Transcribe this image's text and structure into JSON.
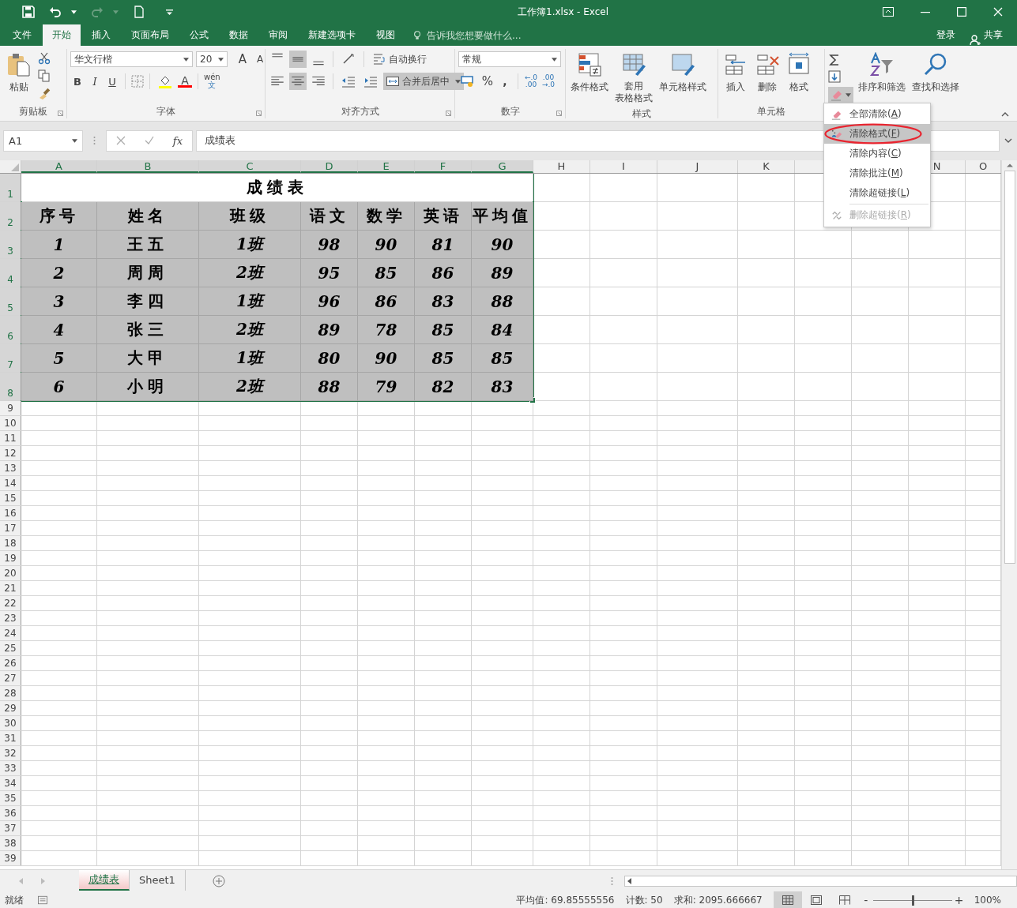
{
  "window": {
    "title": "工作簿1.xlsx - Excel"
  },
  "ribbon_tabs": [
    {
      "label": "文件",
      "selected": false
    },
    {
      "label": "开始",
      "selected": true
    },
    {
      "label": "插入",
      "selected": false
    },
    {
      "label": "页面布局",
      "selected": false
    },
    {
      "label": "公式",
      "selected": false
    },
    {
      "label": "数据",
      "selected": false
    },
    {
      "label": "审阅",
      "selected": false
    },
    {
      "label": "新建选项卡",
      "selected": false
    },
    {
      "label": "视图",
      "selected": false
    }
  ],
  "tell_me": {
    "placeholder": "告诉我您想要做什么..."
  },
  "account": {
    "sign_in": "登录",
    "share": "共享"
  },
  "clipboard": {
    "label": "剪贴板",
    "paste": "粘贴"
  },
  "font": {
    "label": "字体",
    "font_name": "华文行楷",
    "font_size": "20",
    "grow": "A",
    "shrink": "A",
    "bold": "B",
    "italic": "I",
    "underline": "U",
    "font_color_letter": "A",
    "phonetic": {
      "top": "wén",
      "bottom": "文"
    }
  },
  "alignment": {
    "label": "对齐方式",
    "vertical": [
      {
        "kind": "top",
        "selected": false
      },
      {
        "kind": "middle",
        "selected": true
      },
      {
        "kind": "bottom",
        "selected": false
      }
    ],
    "horizontal": [
      {
        "kind": "left",
        "selected": false
      },
      {
        "kind": "center",
        "selected": true
      },
      {
        "kind": "right",
        "selected": false
      }
    ],
    "wrap_text": "自动换行",
    "merge_center": {
      "label": "合并后居中",
      "selected": true
    }
  },
  "number": {
    "label": "数字",
    "format": "常规",
    "percent": "%",
    "comma": ",",
    "increase_decimal": {
      "top": "←.0",
      "bottom": ".00"
    },
    "decrease_decimal": {
      "top": ".00",
      "bottom": "→.0"
    }
  },
  "styles": {
    "label": "样式",
    "conditional": "条件格式",
    "table_format": [
      "套用",
      "表格格式"
    ],
    "cell_styles": "单元格样式"
  },
  "cells": {
    "label": "单元格",
    "insert": "插入",
    "delete": "删除",
    "format": "格式"
  },
  "editing": {
    "sort_filter": "排序和筛选",
    "find_select": "查找和选择",
    "clear_expanded": true
  },
  "clear_menu": [
    {
      "kind": "eraser",
      "before": "全部清除(",
      "key": "A",
      "after": ")",
      "selected": false,
      "circled": false,
      "disabled": false
    },
    {
      "kind": "format",
      "before": "清除格式(",
      "key": "F",
      "after": ")",
      "selected": true,
      "circled": true,
      "disabled": false
    },
    {
      "kind": "none",
      "before": "清除内容(",
      "key": "C",
      "after": ")",
      "selected": false,
      "circled": false,
      "disabled": false
    },
    {
      "kind": "none",
      "before": "清除批注(",
      "key": "M",
      "after": ")",
      "selected": false,
      "circled": false,
      "disabled": false
    },
    {
      "kind": "none",
      "before": "清除超链接(",
      "key": "L",
      "after": ")",
      "selected": false,
      "circled": false,
      "disabled": false
    },
    {
      "kind": "unlink",
      "before": "删除超链接(",
      "key": "R",
      "after": ")",
      "selected": false,
      "circled": false,
      "disabled": true
    }
  ],
  "formula_bar": {
    "name_box": "A1",
    "function_label": "fx",
    "value": "成绩表"
  },
  "sheet": {
    "columns": [
      "A",
      "B",
      "C",
      "D",
      "E",
      "F",
      "G",
      "H",
      "I",
      "J",
      "K",
      "N",
      "O"
    ],
    "row_numbers": [
      "1",
      "2",
      "3",
      "4",
      "5",
      "6",
      "7",
      "8",
      "9",
      "10",
      "11",
      "12",
      "13",
      "14",
      "15",
      "16",
      "17",
      "18",
      "19",
      "20",
      "21",
      "22",
      "23",
      "24",
      "25",
      "26",
      "27",
      "28",
      "29",
      "30",
      "31",
      "32",
      "33",
      "34",
      "35",
      "36",
      "37",
      "38",
      "39"
    ],
    "title": "成绩表",
    "headers": [
      "序号",
      "姓名",
      "班级",
      "语文",
      "数学",
      "英语",
      "平均值"
    ],
    "rows": [
      [
        "1",
        "王五",
        "1班",
        "98",
        "90",
        "81",
        "90"
      ],
      [
        "2",
        "周周",
        "2班",
        "95",
        "85",
        "86",
        "89"
      ],
      [
        "3",
        "李四",
        "1班",
        "96",
        "86",
        "83",
        "88"
      ],
      [
        "4",
        "张三",
        "2班",
        "89",
        "78",
        "85",
        "84"
      ],
      [
        "5",
        "大甲",
        "1班",
        "80",
        "90",
        "85",
        "85"
      ],
      [
        "6",
        "小明",
        "2班",
        "88",
        "79",
        "82",
        "83"
      ]
    ]
  },
  "sheet_tabs": [
    {
      "label": "成绩表",
      "selected": true
    },
    {
      "label": "Sheet1",
      "selected": false
    }
  ],
  "status_bar": {
    "mode": "就绪",
    "average": "平均值: 69.85555556",
    "count": "计数: 50",
    "sum": "求和: 2095.666667",
    "views": [
      {
        "kind": "normal",
        "selected": true
      },
      {
        "kind": "page_layout",
        "selected": false
      },
      {
        "kind": "page_break",
        "selected": false
      }
    ],
    "zoom_out": "-",
    "zoom_in": "+",
    "zoom": {
      "level": 0.5
    },
    "zoom_text": "100%"
  }
}
